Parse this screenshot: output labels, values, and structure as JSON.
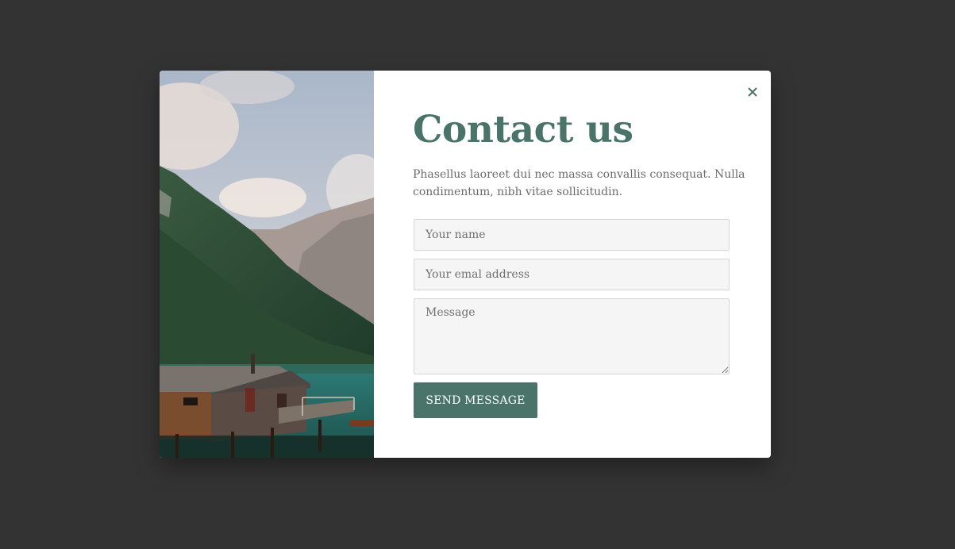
{
  "modal": {
    "title": "Contact us",
    "description": "Phasellus laoreet dui nec massa convallis consequat. Nulla condimentum, nibh vitae sollicitudin.",
    "close_icon": "close-icon",
    "image": "lake-cabin-mountain-photo"
  },
  "form": {
    "name_placeholder": "Your name",
    "email_placeholder": "Your emal address",
    "message_placeholder": "Message",
    "name_value": "",
    "email_value": "",
    "message_value": "",
    "submit_label": "SEND MESSAGE"
  },
  "colors": {
    "backdrop": "#333333",
    "accent": "#4a7369",
    "input_bg": "#f5f5f5",
    "text": "#6b6b6b"
  }
}
